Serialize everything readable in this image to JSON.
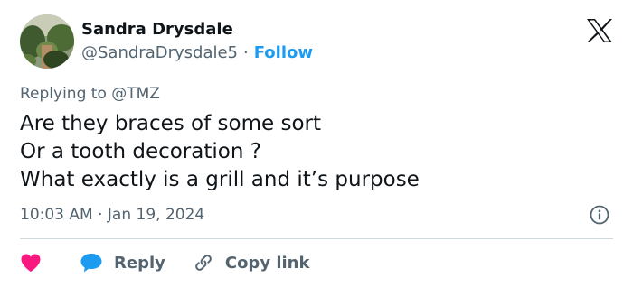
{
  "author": {
    "display_name": "Sandra Drysdale",
    "handle": "@SandraDrysdale5",
    "separator": "·",
    "follow_label": "Follow"
  },
  "reply_context": {
    "prefix": "Replying to ",
    "mention": "@TMZ"
  },
  "tweet": {
    "lines": [
      "Are they braces of some sort",
      "Or a tooth decoration ?",
      "What exactly is a grill and it’s purpose"
    ],
    "timestamp": "10:03 AM · Jan 19, 2024"
  },
  "actions": {
    "reply_label": "Reply",
    "copy_link_label": "Copy link"
  },
  "icons": {
    "brand": "x-logo-icon",
    "like": "heart-icon",
    "reply": "speech-bubble-icon",
    "copy": "link-icon",
    "info": "info-icon"
  },
  "colors": {
    "accent": "#1d9bf0",
    "like": "#f91880",
    "muted_text": "#536471",
    "main_text": "#0f1419"
  }
}
